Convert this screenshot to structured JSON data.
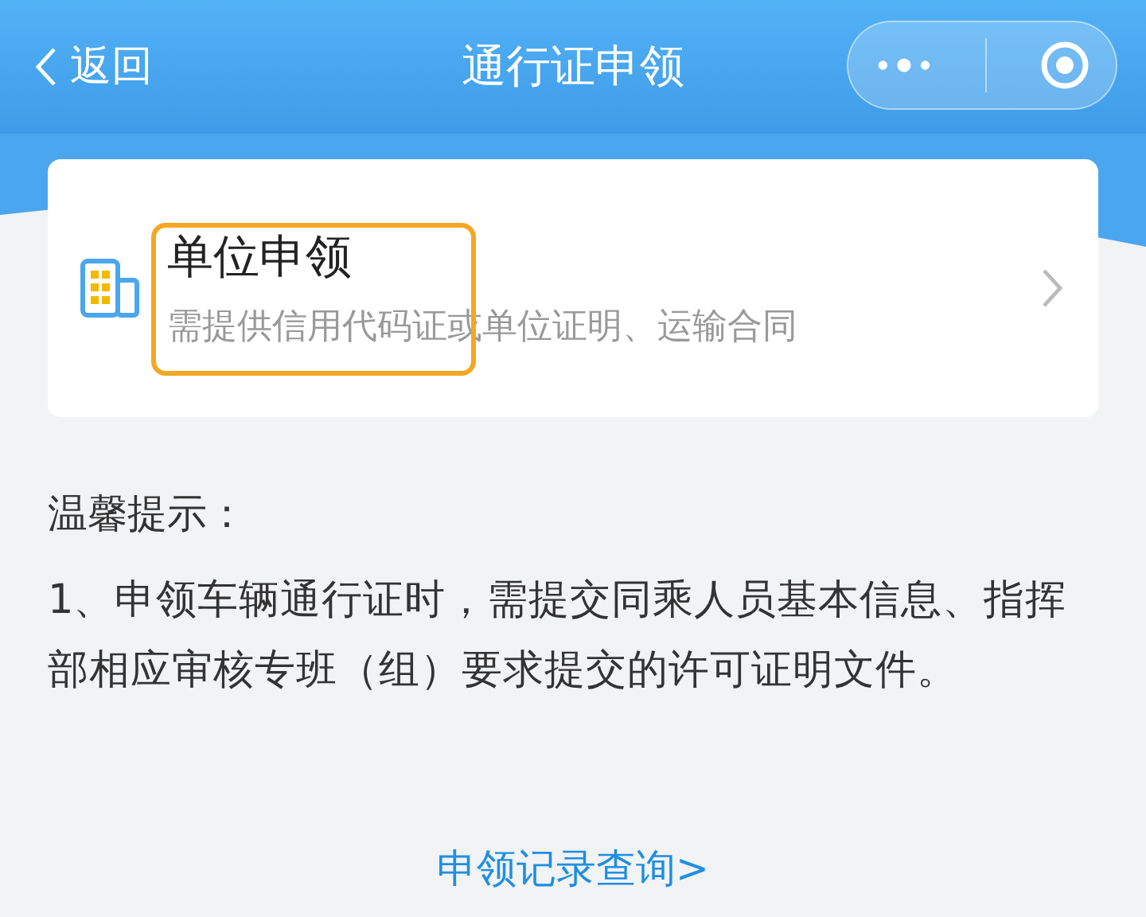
{
  "nav": {
    "back": "返回",
    "title": "通行证申领"
  },
  "options": [
    {
      "title": "单位申领",
      "description": "需提供信用代码证或单位证明、运输合同",
      "highlighted": true
    }
  ],
  "tips": {
    "heading": "温馨提示：",
    "items": [
      "1、申领车辆通行证时，需提交同乘人员基本信息、指挥部相应审核专班（组）要求提交的许可证明文件。"
    ]
  },
  "link": "申领记录查询>"
}
